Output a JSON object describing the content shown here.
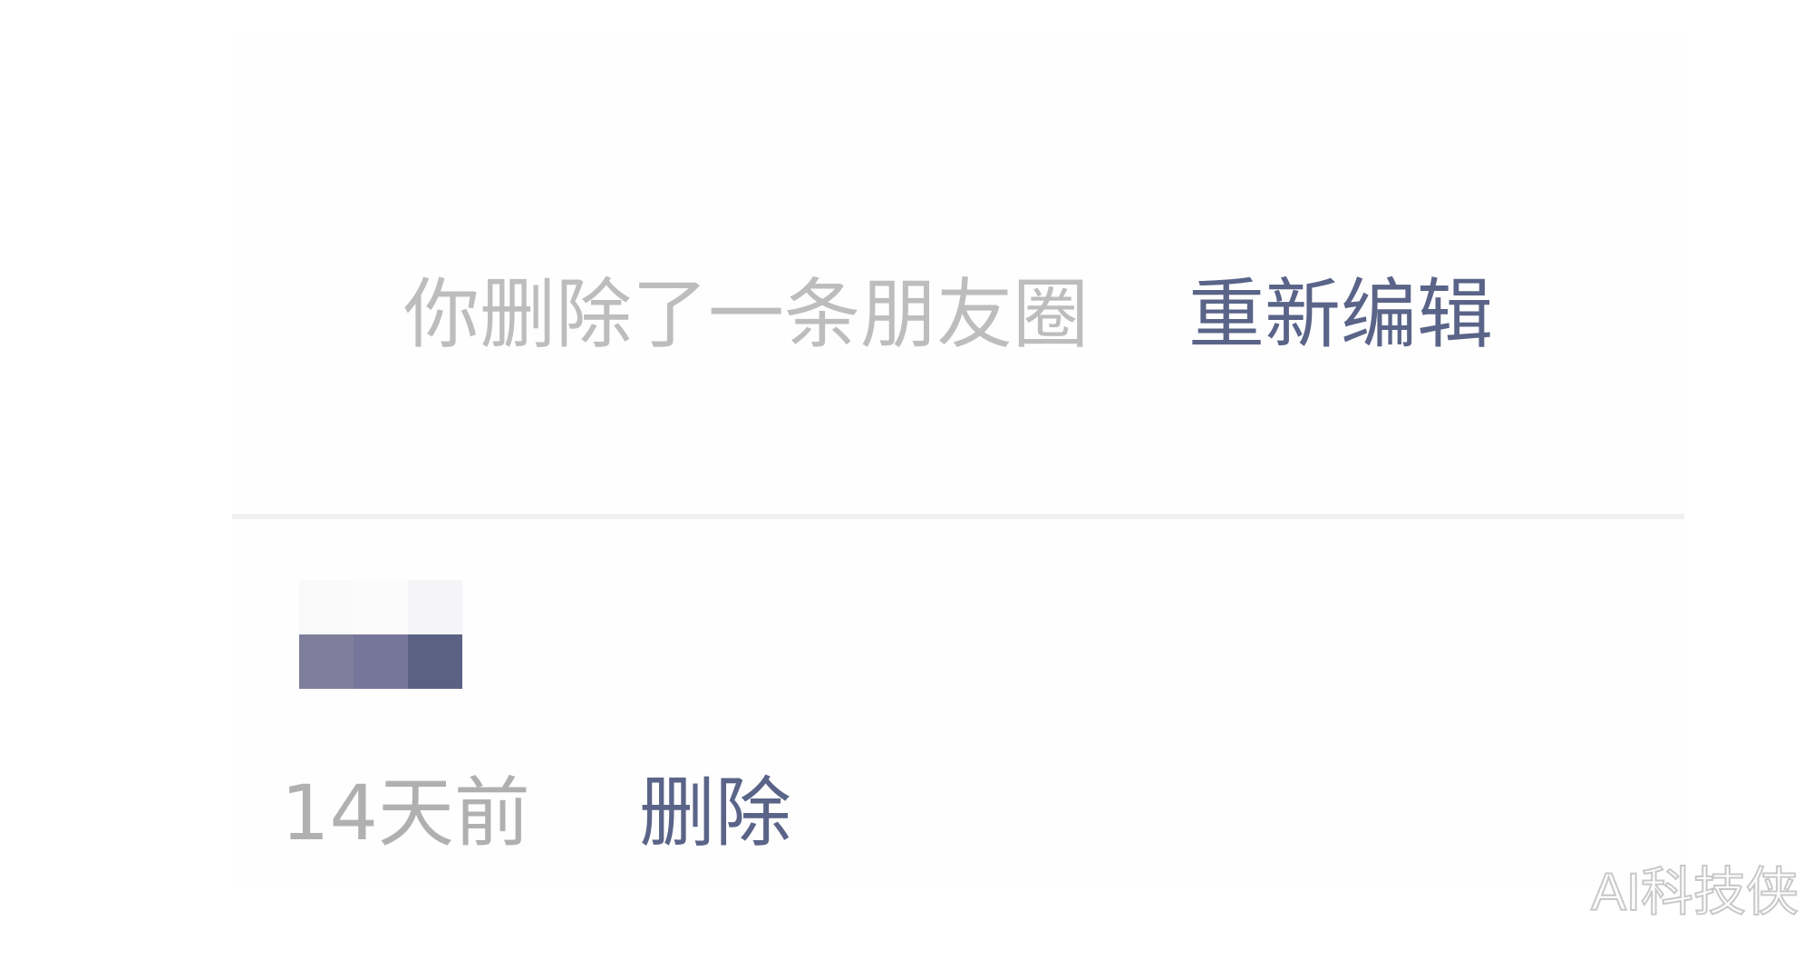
{
  "moment_notice": {
    "deleted_text": "你删除了一条朋友圈",
    "re_edit_label": "重新编辑"
  },
  "redacted_content": {
    "colors": [
      "#fbfafa",
      "#fcfbfb",
      "#f5f5f8",
      "#7f7f9c",
      "#76769a",
      "#5b6182"
    ]
  },
  "meta": {
    "time_ago": "14天前",
    "delete_label": "删除"
  },
  "watermark": {
    "text": "AI科技侠"
  },
  "colors": {
    "muted_text": "#bdbdbd",
    "link_blue": "#5a6488",
    "divider": "#f0f0f0"
  }
}
